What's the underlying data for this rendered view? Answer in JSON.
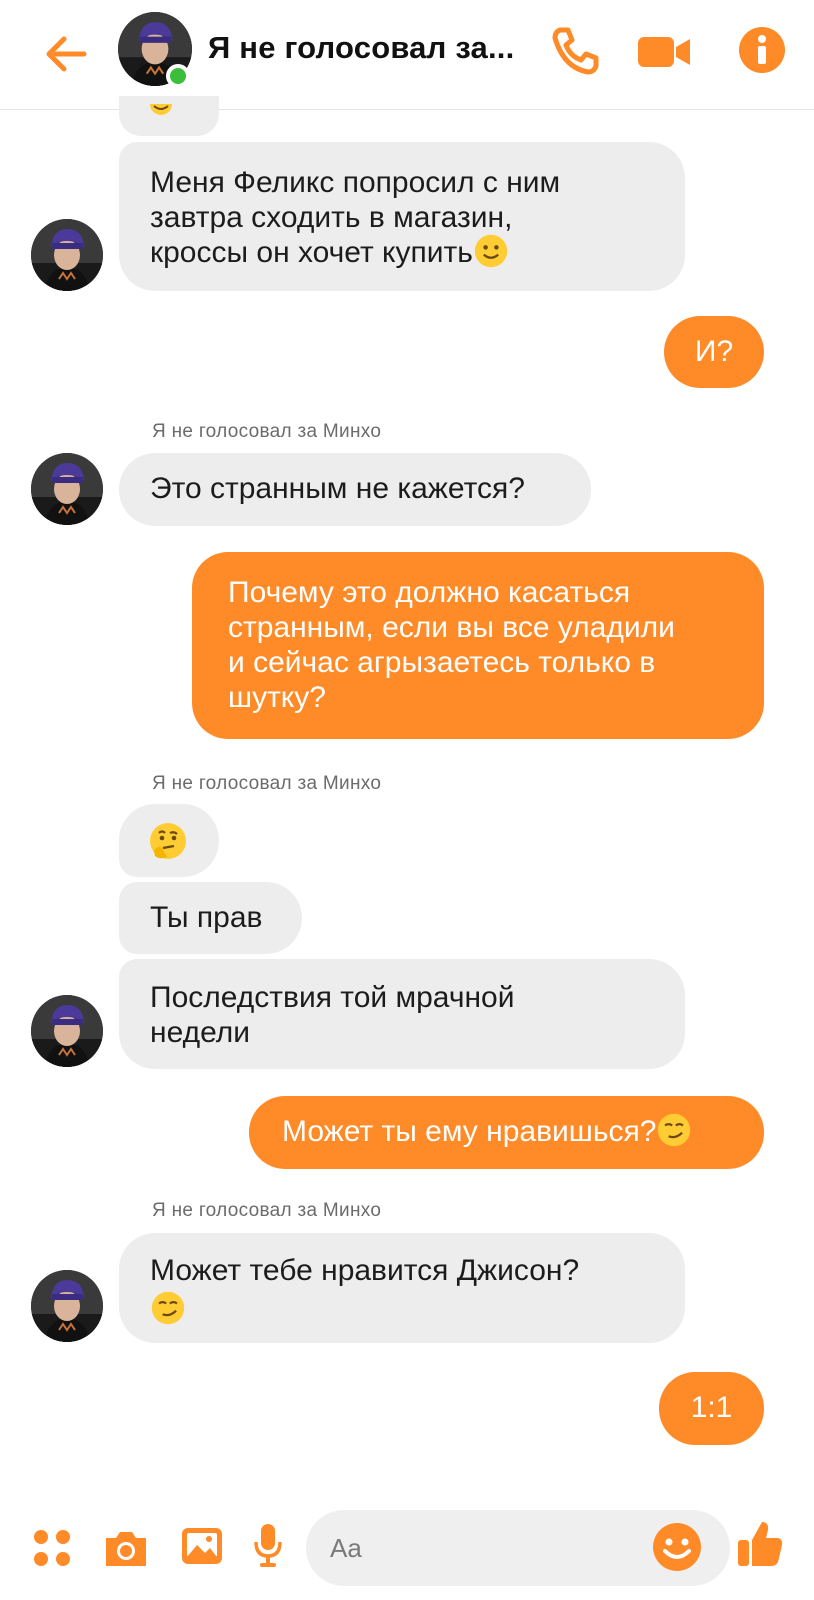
{
  "header": {
    "back_icon": "arrow-left-icon",
    "title": "Я не голосовал за...",
    "online": true,
    "icons": [
      "phone-icon",
      "video-camera-icon",
      "info-icon"
    ],
    "accent_color": "#FF8A28"
  },
  "messages": [
    {
      "side": "in",
      "text": "Меня Феликс попросил с ним завтра сходить в магазин, кроссы он хочет купить",
      "emoji": "slight-smile"
    },
    {
      "side": "out",
      "text": "И?"
    },
    {
      "side": "in",
      "sender": "Я не голосовал за Минхо",
      "text": "Это странным не кажется?"
    },
    {
      "side": "out",
      "text": "Почему это должно касаться странным, если вы все уладили и сейчас агрызаетесь только в шутку?"
    },
    {
      "side": "in",
      "sender": "Я не голосовал за Минхо",
      "emoji": "thinking-face"
    },
    {
      "side": "in",
      "text": "Ты прав"
    },
    {
      "side": "in",
      "text": "Последствия той мрачной недели"
    },
    {
      "side": "out",
      "text": "Может ты ему нравишься?",
      "emoji": "smirking-face"
    },
    {
      "side": "in",
      "sender": "Я не голосовал за Минхо",
      "text": "Может тебе нравится Джисон?",
      "emoji": "smirking-face"
    },
    {
      "side": "out",
      "text": "1:1"
    }
  ],
  "msg": {
    "m1_line1": "Меня Феликс попросил с ним",
    "m1_line2": "завтра сходить в магазин,",
    "m1_line3": "кроссы он хочет купить",
    "m2": "И?",
    "sender_label": "Я не голосовал за Минхо",
    "m3": "Это странным не кажется?",
    "m4_line1": "Почему это должно касаться",
    "m4_line2": "странным, если вы все уладили",
    "m4_line3": "и сейчас агрызаетесь только в",
    "m4_line4": "шутку?",
    "m6": "Ты прав",
    "m7_line1": "Последствия той мрачной",
    "m7_line2": "недели",
    "m8": "Может ты ему нравишься?",
    "m9": "Может тебе нравится Джисон?",
    "m10": "1:1"
  },
  "composer": {
    "placeholder": "Aa",
    "icons": [
      "apps-icon",
      "camera-icon",
      "gallery-icon",
      "microphone-icon",
      "emoji-icon",
      "thumbs-up-icon"
    ]
  }
}
